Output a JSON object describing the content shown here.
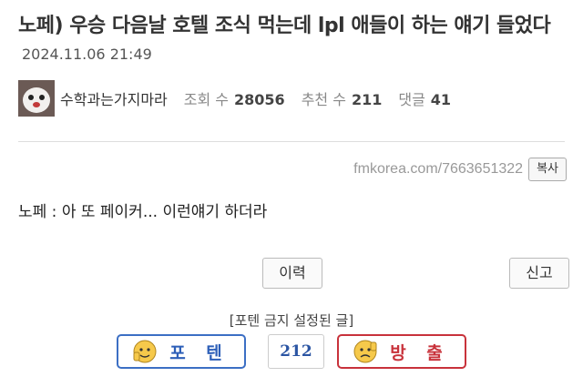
{
  "post": {
    "title": "노페) 우승 다음날 호텔 조식 먹는데 lpl 애들이 하는 얘기 들었다",
    "date": "2024.11.06 21:49",
    "author": "수학과는가지마라",
    "views_label": "조회 수",
    "views": "28056",
    "likes_label": "추천 수",
    "likes": "211",
    "comments_label": "댓글",
    "comments": "41",
    "url": "fmkorea.com/7663651322",
    "copy_label": "복사",
    "body": "노페 : 아 또 페이커... 이런얘기 하더라"
  },
  "actions": {
    "history_label": "이력",
    "report_label": "신고",
    "forbid_notice": "[포텐 금지 설정된 글]",
    "upvote_label": "포 텐",
    "vote_count": "212",
    "downvote_label": "방 출"
  },
  "colors": {
    "upvote": "#3c6fc4",
    "downvote": "#c8323b",
    "vote_count": "#2b55a3"
  }
}
